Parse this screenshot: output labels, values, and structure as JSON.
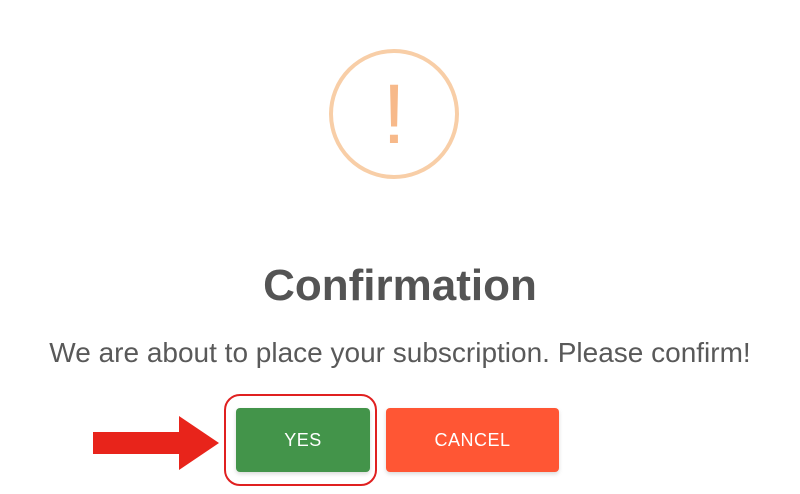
{
  "dialog": {
    "icon": "exclamation-icon",
    "icon_glyph": "!",
    "title": "Confirmation",
    "message": "We are about to place your subscription. Please confirm!",
    "yes_label": "YES",
    "cancel_label": "CANCEL"
  },
  "annotation": {
    "pointer": "red-arrow-icon",
    "highlight": "red-outline-around-yes"
  },
  "colors": {
    "icon_ring": "#f8cea7",
    "icon_glyph": "#f7b98a",
    "title": "#545454",
    "message": "#595959",
    "yes_button": "#43944a",
    "cancel_button": "#ff5634",
    "annotation_red": "#e02020"
  }
}
